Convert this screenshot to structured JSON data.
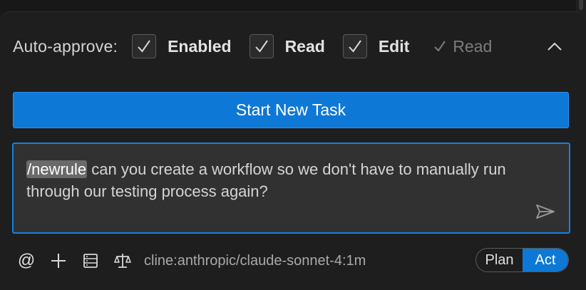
{
  "auto_approve": {
    "label": "Auto-approve:",
    "options": [
      {
        "label": "Enabled",
        "checked": true
      },
      {
        "label": "Read",
        "checked": true
      },
      {
        "label": "Edit",
        "checked": true
      }
    ],
    "summary": "Read",
    "collapse_icon": "chevron-up-icon"
  },
  "primary_button": {
    "label": "Start New Task",
    "color": "#0e78d6"
  },
  "chat_input": {
    "mention": "/newrule",
    "text": " can you create a workflow so we don't have to manually run through our testing process again?",
    "send_icon": "send-icon"
  },
  "toolbar": {
    "icons": [
      "at-mention-icon",
      "add-icon",
      "server-icon",
      "scale-icon"
    ],
    "at_symbol": "@",
    "model": "cline:anthropic/claude-sonnet-4:1m"
  },
  "mode_toggle": {
    "plan_label": "Plan",
    "act_label": "Act",
    "active": "Act",
    "active_color": "#0e78d6"
  }
}
